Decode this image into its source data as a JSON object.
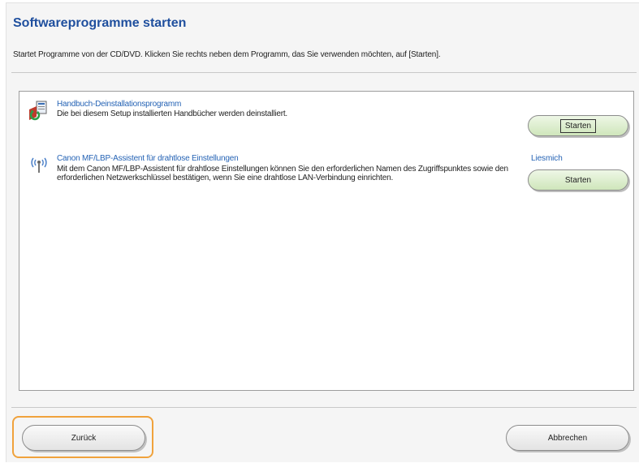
{
  "header": {
    "title": "Softwareprogramme starten",
    "description": "Startet Programme von der CD/DVD. Klicken Sie rechts neben dem Programm, das Sie verwenden möchten, auf [Starten]."
  },
  "programs": [
    {
      "icon": "uninstall-manual-icon",
      "name": "Handbuch-Deinstallationsprogramm",
      "description": "Die bei diesem Setup installierten Handbücher werden deinstalliert.",
      "start_label": "Starten"
    },
    {
      "icon": "wireless-antenna-icon",
      "name": "Canon MF/LBP-Assistent für drahtlose Einstellungen",
      "description": "Mit dem Canon MF/LBP-Assistent für drahtlose Einstellungen können Sie den erforderlichen Namen des Zugriffspunktes sowie den erforderlichen Netzwerkschlüssel bestätigen, wenn Sie eine drahtlose LAN-Verbindung einrichten.",
      "readme_label": "Liesmich",
      "start_label": "Starten"
    }
  ],
  "footer": {
    "back_label": "Zurück",
    "cancel_label": "Abbrechen"
  },
  "colors": {
    "title": "#1f4f9e",
    "link": "#2563b5",
    "highlight": "#f0a23c",
    "start_button": "#dbeecb"
  }
}
